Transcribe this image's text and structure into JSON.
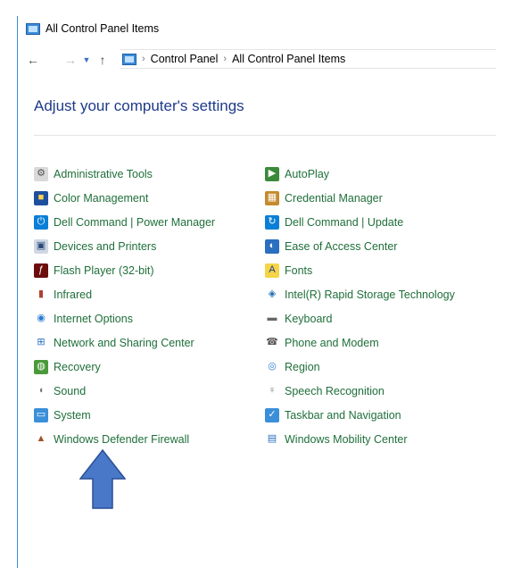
{
  "window": {
    "title": "All Control Panel Items"
  },
  "address": {
    "crumbs": [
      "Control Panel",
      "All Control Panel Items"
    ]
  },
  "heading": "Adjust your computer's settings",
  "left_items": [
    {
      "label": "Administrative Tools",
      "icon": "admin-tools-icon",
      "glyph": "⚙",
      "bg": "#d9d9d9",
      "fg": "#555"
    },
    {
      "label": "Color Management",
      "icon": "color-management-icon",
      "glyph": "■",
      "bg": "#1e4f9e",
      "fg": "#ffd34d"
    },
    {
      "label": "Dell Command | Power Manager",
      "icon": "dell-power-manager-icon",
      "glyph": "⏻",
      "bg": "#0a7fd6",
      "fg": "#fff"
    },
    {
      "label": "Devices and Printers",
      "icon": "devices-printers-icon",
      "glyph": "▣",
      "bg": "#cfd8e3",
      "fg": "#2b4a7a"
    },
    {
      "label": "Flash Player (32-bit)",
      "icon": "flash-player-icon",
      "glyph": "ƒ",
      "bg": "#6b0d0d",
      "fg": "#fff"
    },
    {
      "label": "Infrared",
      "icon": "infrared-icon",
      "glyph": "▮",
      "bg": "#ffffff",
      "fg": "#b04030"
    },
    {
      "label": "Internet Options",
      "icon": "internet-options-icon",
      "glyph": "◉",
      "bg": "#ffffff",
      "fg": "#2a7bd0"
    },
    {
      "label": "Network and Sharing Center",
      "icon": "network-sharing-icon",
      "glyph": "⊞",
      "bg": "#ffffff",
      "fg": "#2a6fc0"
    },
    {
      "label": "Recovery",
      "icon": "recovery-icon",
      "glyph": "◍",
      "bg": "#4a9a3a",
      "fg": "#fff"
    },
    {
      "label": "Sound",
      "icon": "sound-icon",
      "glyph": "◖",
      "bg": "#ffffff",
      "fg": "#777"
    },
    {
      "label": "System",
      "icon": "system-icon",
      "glyph": "▭",
      "bg": "#3b8fd9",
      "fg": "#fff"
    },
    {
      "label": "Windows Defender Firewall",
      "icon": "firewall-icon",
      "glyph": "▲",
      "bg": "#ffffff",
      "fg": "#a0522d"
    }
  ],
  "right_items": [
    {
      "label": "AutoPlay",
      "icon": "autoplay-icon",
      "glyph": "▶",
      "bg": "#3a8a3a",
      "fg": "#fff"
    },
    {
      "label": "Credential Manager",
      "icon": "credential-manager-icon",
      "glyph": "▦",
      "bg": "#c58a2e",
      "fg": "#fff"
    },
    {
      "label": "Dell Command | Update",
      "icon": "dell-update-icon",
      "glyph": "↻",
      "bg": "#0a7fd6",
      "fg": "#fff"
    },
    {
      "label": "Ease of Access Center",
      "icon": "ease-of-access-icon",
      "glyph": "◐",
      "bg": "#2a6fc0",
      "fg": "#fff"
    },
    {
      "label": "Fonts",
      "icon": "fonts-icon",
      "glyph": "A",
      "bg": "#f5d547",
      "fg": "#1e3a8a"
    },
    {
      "label": "Intel(R) Rapid Storage Technology",
      "icon": "intel-rst-icon",
      "glyph": "◈",
      "bg": "#ffffff",
      "fg": "#1b6fb5"
    },
    {
      "label": "Keyboard",
      "icon": "keyboard-icon",
      "glyph": "▬",
      "bg": "#ffffff",
      "fg": "#666"
    },
    {
      "label": "Phone and Modem",
      "icon": "phone-modem-icon",
      "glyph": "☎",
      "bg": "#ffffff",
      "fg": "#555"
    },
    {
      "label": "Region",
      "icon": "region-icon",
      "glyph": "◎",
      "bg": "#ffffff",
      "fg": "#2a7bd0"
    },
    {
      "label": "Speech Recognition",
      "icon": "speech-recognition-icon",
      "glyph": "♀",
      "bg": "#ffffff",
      "fg": "#666"
    },
    {
      "label": "Taskbar and Navigation",
      "icon": "taskbar-navigation-icon",
      "glyph": "✓",
      "bg": "#3b8fd9",
      "fg": "#fff"
    },
    {
      "label": "Windows Mobility Center",
      "icon": "mobility-center-icon",
      "glyph": "▤",
      "bg": "#ffffff",
      "fg": "#2a6fc0"
    }
  ],
  "annotation": {
    "color": "#4a78c8",
    "stroke": "#2a4f96"
  }
}
